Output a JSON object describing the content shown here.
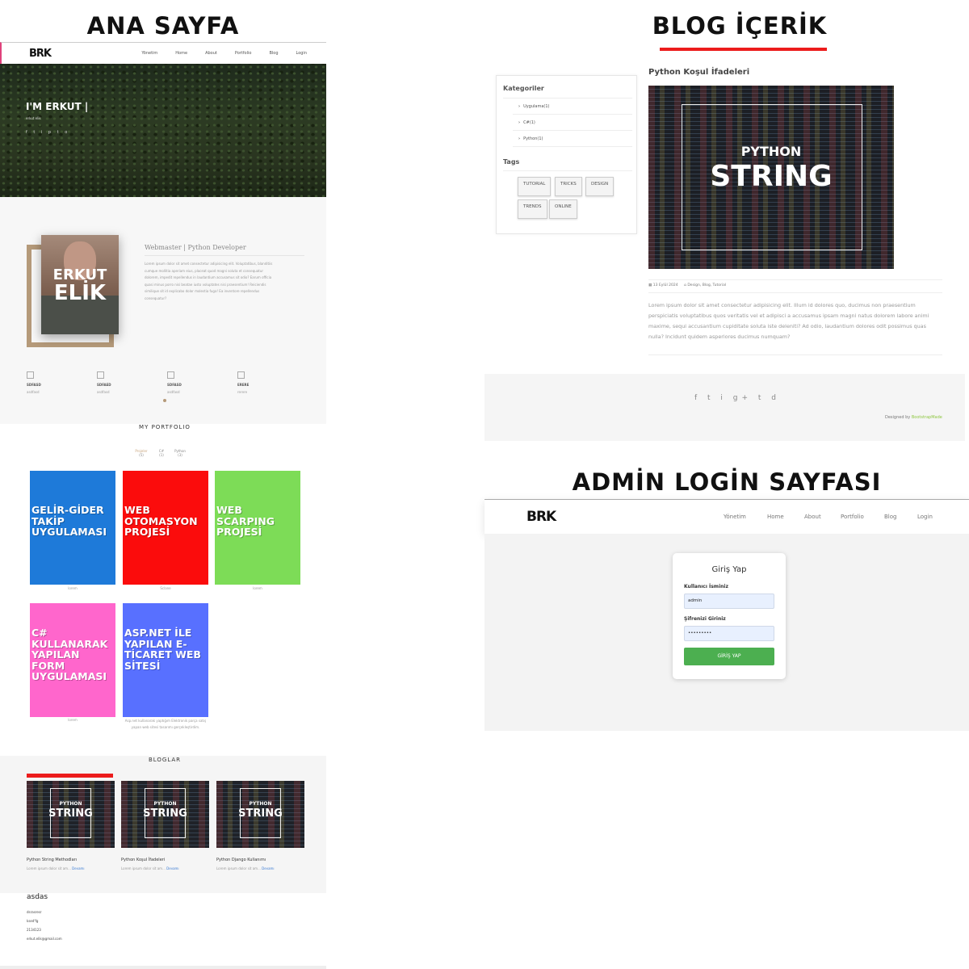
{
  "headings": {
    "home": "ANA SAYFA",
    "blog": "BLOG İÇERİK",
    "admin": "ADMİN LOGİN SAYFASI"
  },
  "accent": "#ec1c1c",
  "logo": "BRK",
  "home": {
    "nav": [
      "Yönetim",
      "Home",
      "About",
      "Portfolio",
      "Blog",
      "Login"
    ],
    "hero": {
      "title": "I'M ERKUT |",
      "subtitle": "erkut elik",
      "social": "f t i p t o"
    },
    "about": {
      "photo_name_1": "ERKUT",
      "photo_name_2": "ELİK",
      "role": "Webmaster | Python Developer",
      "text": "Lorem ipsum dolor sit amet consectetur adipisicing elit. Voluptatibus, blanditiis cumque mollitia aperiam eius, placeat quod magni soluta et consequatur dolorem, impedit repellendus in laudantium accusamus sit odio? Earum officia quasi minus porro nisi beatae iusto voluptates nisi praesentium! Reiciendis similique sit id explicabo dolor molestia fuga! Ea inventore repellendus consequatur?"
    },
    "stats": [
      {
        "title": "SDFASD",
        "sub": "asdfasd"
      },
      {
        "title": "SDFAED",
        "sub": "asdfasd"
      },
      {
        "title": "SDFASD",
        "sub": "asdfasd"
      },
      {
        "title": "ERERE",
        "sub": "rerere"
      }
    ],
    "portfolio": {
      "title": "MY PORTFOLIO",
      "filters": [
        {
          "label": "Projeler",
          "count": "(5)"
        },
        {
          "label": "C#",
          "count": "(1)"
        },
        {
          "label": "Python",
          "count": "(3)"
        }
      ],
      "tiles": [
        {
          "text": "GELİR-GİDER TAKİP UYGULAMASI",
          "color": "#1e7ad9",
          "caption": "lorem"
        },
        {
          "text": "WEB OTOMASYON PROJESİ",
          "color": "#fb0c0c",
          "caption": "Sclane"
        },
        {
          "text": "WEB SCARPING PROJESİ",
          "color": "#7ddc57",
          "caption": "lorem"
        },
        {
          "text": "C# KULLANARAK YAPILAN FORM UYGULAMASI",
          "color": "#ff66cc",
          "caption": "lorem"
        },
        {
          "text": "ASP.NET İLE YAPILAN E- TİCARET WEB SİTESİ",
          "color": "#5870ff",
          "caption": "Asp.net kullanarak yaptığım Elektronik parça satış yapan web sitesi tasarımı gerçekleştirdim."
        }
      ]
    },
    "blogs": {
      "title": "BLOGLAR",
      "image_text_small": "PYTHON",
      "image_text_big": "STRING",
      "more": "Devamı",
      "items": [
        {
          "title": "Python String Methodları",
          "excerpt": "Lorem ipsum dolor sit am..."
        },
        {
          "title": "Python Koşul İfadeleri",
          "excerpt": "Lorem ipsum dolor sit am..."
        },
        {
          "title": "Python Django Kullanımı",
          "excerpt": "Lorem ipsum dolor sit am..."
        }
      ]
    },
    "contact": {
      "heading": "asdas",
      "lines": [
        "dsrasresr",
        "ksed'fg",
        "2134123",
        "erkut.elik@gmail.com"
      ]
    }
  },
  "blog": {
    "sidebar": {
      "categories_title": "Kategoriler",
      "categories": [
        "Uygulama(1)",
        "C#(1)",
        "Python(1)"
      ],
      "tags_title": "Tags",
      "tags": [
        "TUTORIAL",
        "TRICKS",
        "DESIGN",
        "TRENDS",
        "ONLINE"
      ]
    },
    "post": {
      "title": "Python Koşul İfadeleri",
      "image_small": "PYTHON",
      "image_big": "STRING",
      "date": "13 Eylül 2024",
      "tags": "Design, Blog, Tutorial",
      "text": "Lorem ipsum dolor sit amet consectetur adipisicing elit. Illum id dolores quo, ducimus non praesentium perspiciatis voluptatibus quos veritatis vel et adipisci a accusamus ipsam magni natus dolorem labore animi maxime, sequi accusantium cupiditate soluta iste deleniti? Ad odio, laudantium dolores odit possimus quas nulla? Incidunt quidem asperiores ducimus numquam?"
    },
    "footer": {
      "social": "f t i g+ t d",
      "designed_prefix": "Designed by",
      "designed_by": "BootstrapMade"
    }
  },
  "admin": {
    "logo": "BRK",
    "nav": [
      "Yönetim",
      "Home",
      "About",
      "Portfolio",
      "Blog",
      "Login"
    ],
    "login": {
      "title": "Giriş Yap",
      "username_label": "Kullanıcı İsminiz",
      "username_value": "admin",
      "password_label": "Şifrenizi Giriniz",
      "password_value": "•••••••••",
      "button": "GİRİŞ YAP"
    }
  }
}
